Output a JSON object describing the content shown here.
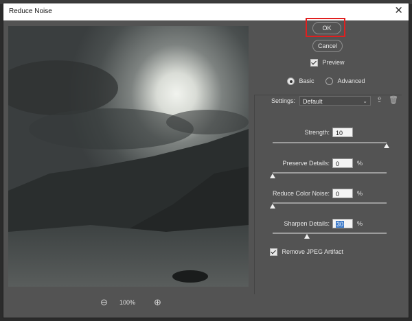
{
  "dialog": {
    "title": "Reduce Noise",
    "ok_label": "OK",
    "cancel_label": "Cancel",
    "preview_label": "Preview",
    "preview_checked": true,
    "mode_basic_label": "Basic",
    "mode_advanced_label": "Advanced",
    "mode_selected": "Basic"
  },
  "settings": {
    "label": "Settings:",
    "value": "Default",
    "save_icon": "save-preset-icon",
    "delete_icon": "trash-icon"
  },
  "sliders": {
    "strength": {
      "label": "Strength:",
      "value": "10",
      "unit": "",
      "level": 1.0
    },
    "preserve": {
      "label": "Preserve Details:",
      "value": "0",
      "unit": "%",
      "level": 0.0
    },
    "color_noise": {
      "label": "Reduce Color Noise:",
      "value": "0",
      "unit": "%",
      "level": 0.0
    },
    "sharpen": {
      "label": "Sharpen Details:",
      "value": "30",
      "unit": "%",
      "level": 0.3
    }
  },
  "jpeg": {
    "label": "Remove JPEG Artifact",
    "checked": true
  },
  "zoom": {
    "level": "100%",
    "zoom_out_icon": "zoom-out-icon",
    "zoom_in_icon": "zoom-in-icon"
  },
  "colors": {
    "highlight": "#e01f1f",
    "dialog_bg": "#535353",
    "selection": "#3a78c8"
  }
}
